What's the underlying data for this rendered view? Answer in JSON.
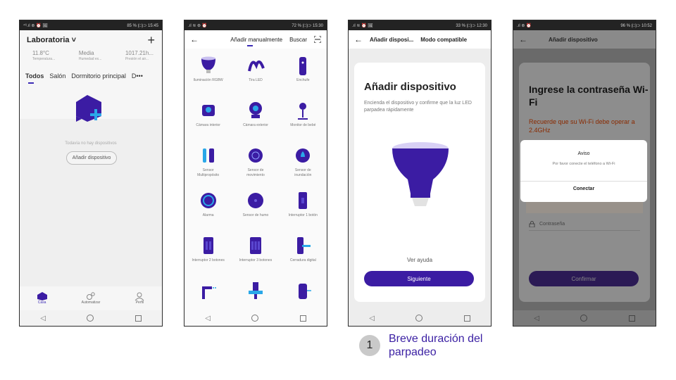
{
  "colors": {
    "accent": "#3b2bb5",
    "button": "#3b1ca3",
    "caption_text": "#3a1fa3"
  },
  "phone1": {
    "status_right": "85 % (□)⊃ 15:45",
    "status_left": "⁴⁶.ıl ⊛ ⏰ 🖼",
    "home_name": "Laboratoria ˅",
    "plus": "+",
    "weather": [
      {
        "value": "11.8°C",
        "label": "Temperatura..."
      },
      {
        "value": "Media",
        "label": "Humedad ex..."
      },
      {
        "value": "1017.21h...",
        "label": "Presión el air..."
      }
    ],
    "rooms": [
      "Todos",
      "Salón",
      "Dormitorio principal",
      "D•••"
    ],
    "empty_text": "Todavía no hay dispositivos",
    "add_button": "Añadir dispositivo",
    "tabs": [
      {
        "label": "Casa",
        "icon": "home-icon"
      },
      {
        "label": "Automatizar",
        "icon": "gears-icon"
      },
      {
        "label": "Perfil",
        "icon": "person-icon"
      }
    ]
  },
  "phone2": {
    "status_right": "72 % (□)⊃ 15:30",
    "status_left": ".ıl ≋ ⊛ ⏰",
    "back": "←",
    "tab_active": "Añadir manualmente",
    "tab_other": "Buscar",
    "scan_icon": "scan-icon",
    "devices": [
      {
        "name": "Iluminación RGBW",
        "icon": "bulb-icon"
      },
      {
        "name": "Tira LED",
        "icon": "led-strip-icon"
      },
      {
        "name": "Enchufe",
        "icon": "plug-icon"
      },
      {
        "name": "Cámara interior",
        "icon": "camera-indoor-icon"
      },
      {
        "name": "Cámara exterior",
        "icon": "camera-outdoor-icon"
      },
      {
        "name": "Monitor de bebé",
        "icon": "baby-monitor-icon"
      },
      {
        "name": "Sensor Multipropósito",
        "icon": "multi-sensor-icon"
      },
      {
        "name": "Sensor de movimiento",
        "icon": "motion-sensor-icon"
      },
      {
        "name": "Sensor de inundación",
        "icon": "flood-sensor-icon"
      },
      {
        "name": "Alarma",
        "icon": "alarm-icon"
      },
      {
        "name": "Sensor de humo",
        "icon": "smoke-sensor-icon"
      },
      {
        "name": "Interruptor 1 botón",
        "icon": "switch-1-icon"
      },
      {
        "name": "Interruptor 2 botones",
        "icon": "switch-2-icon"
      },
      {
        "name": "Interruptor 3 botones",
        "icon": "switch-3-icon"
      },
      {
        "name": "Cerradura digital",
        "icon": "lock-icon"
      },
      {
        "name": "",
        "icon": "faucet-icon"
      },
      {
        "name": "",
        "icon": "water-valve-icon"
      },
      {
        "name": "",
        "icon": "ir-remote-icon"
      }
    ]
  },
  "phone3": {
    "status_right": "33 % (□)⊃ 12:30",
    "status_left": ".ıl ≋ ⏰ 🖼",
    "back": "←",
    "title": "Añadir disposi...",
    "mode": "Modo compatible",
    "heading": "Añadir dispositivo",
    "description": "Encienda el dispositivo y confirme que la luz LED parpadea rápidamente",
    "help": "Ver ayuda",
    "next": "Siguiente"
  },
  "phone4": {
    "status_right": "96 % (□)⊃ 10:52",
    "status_left": ".ıl ⊛ ⏰",
    "back": "←",
    "title": "Añadir dispositivo",
    "heading": "Ingrese la contraseña Wi-Fi",
    "warning": "Recuerde que su Wi-Fi debe operar a 2.4GHz",
    "note": "Por favor conecte el teléfono a Wi-Fi",
    "password_placeholder": "Contraseña",
    "confirm": "Confirmar",
    "dialog": {
      "title": "Aviso",
      "message": "Por favor conecte el teléfono a Wi-Fi",
      "button": "Conectar"
    }
  },
  "caption": {
    "number": "1",
    "text": "Breve duración del parpadeo"
  }
}
